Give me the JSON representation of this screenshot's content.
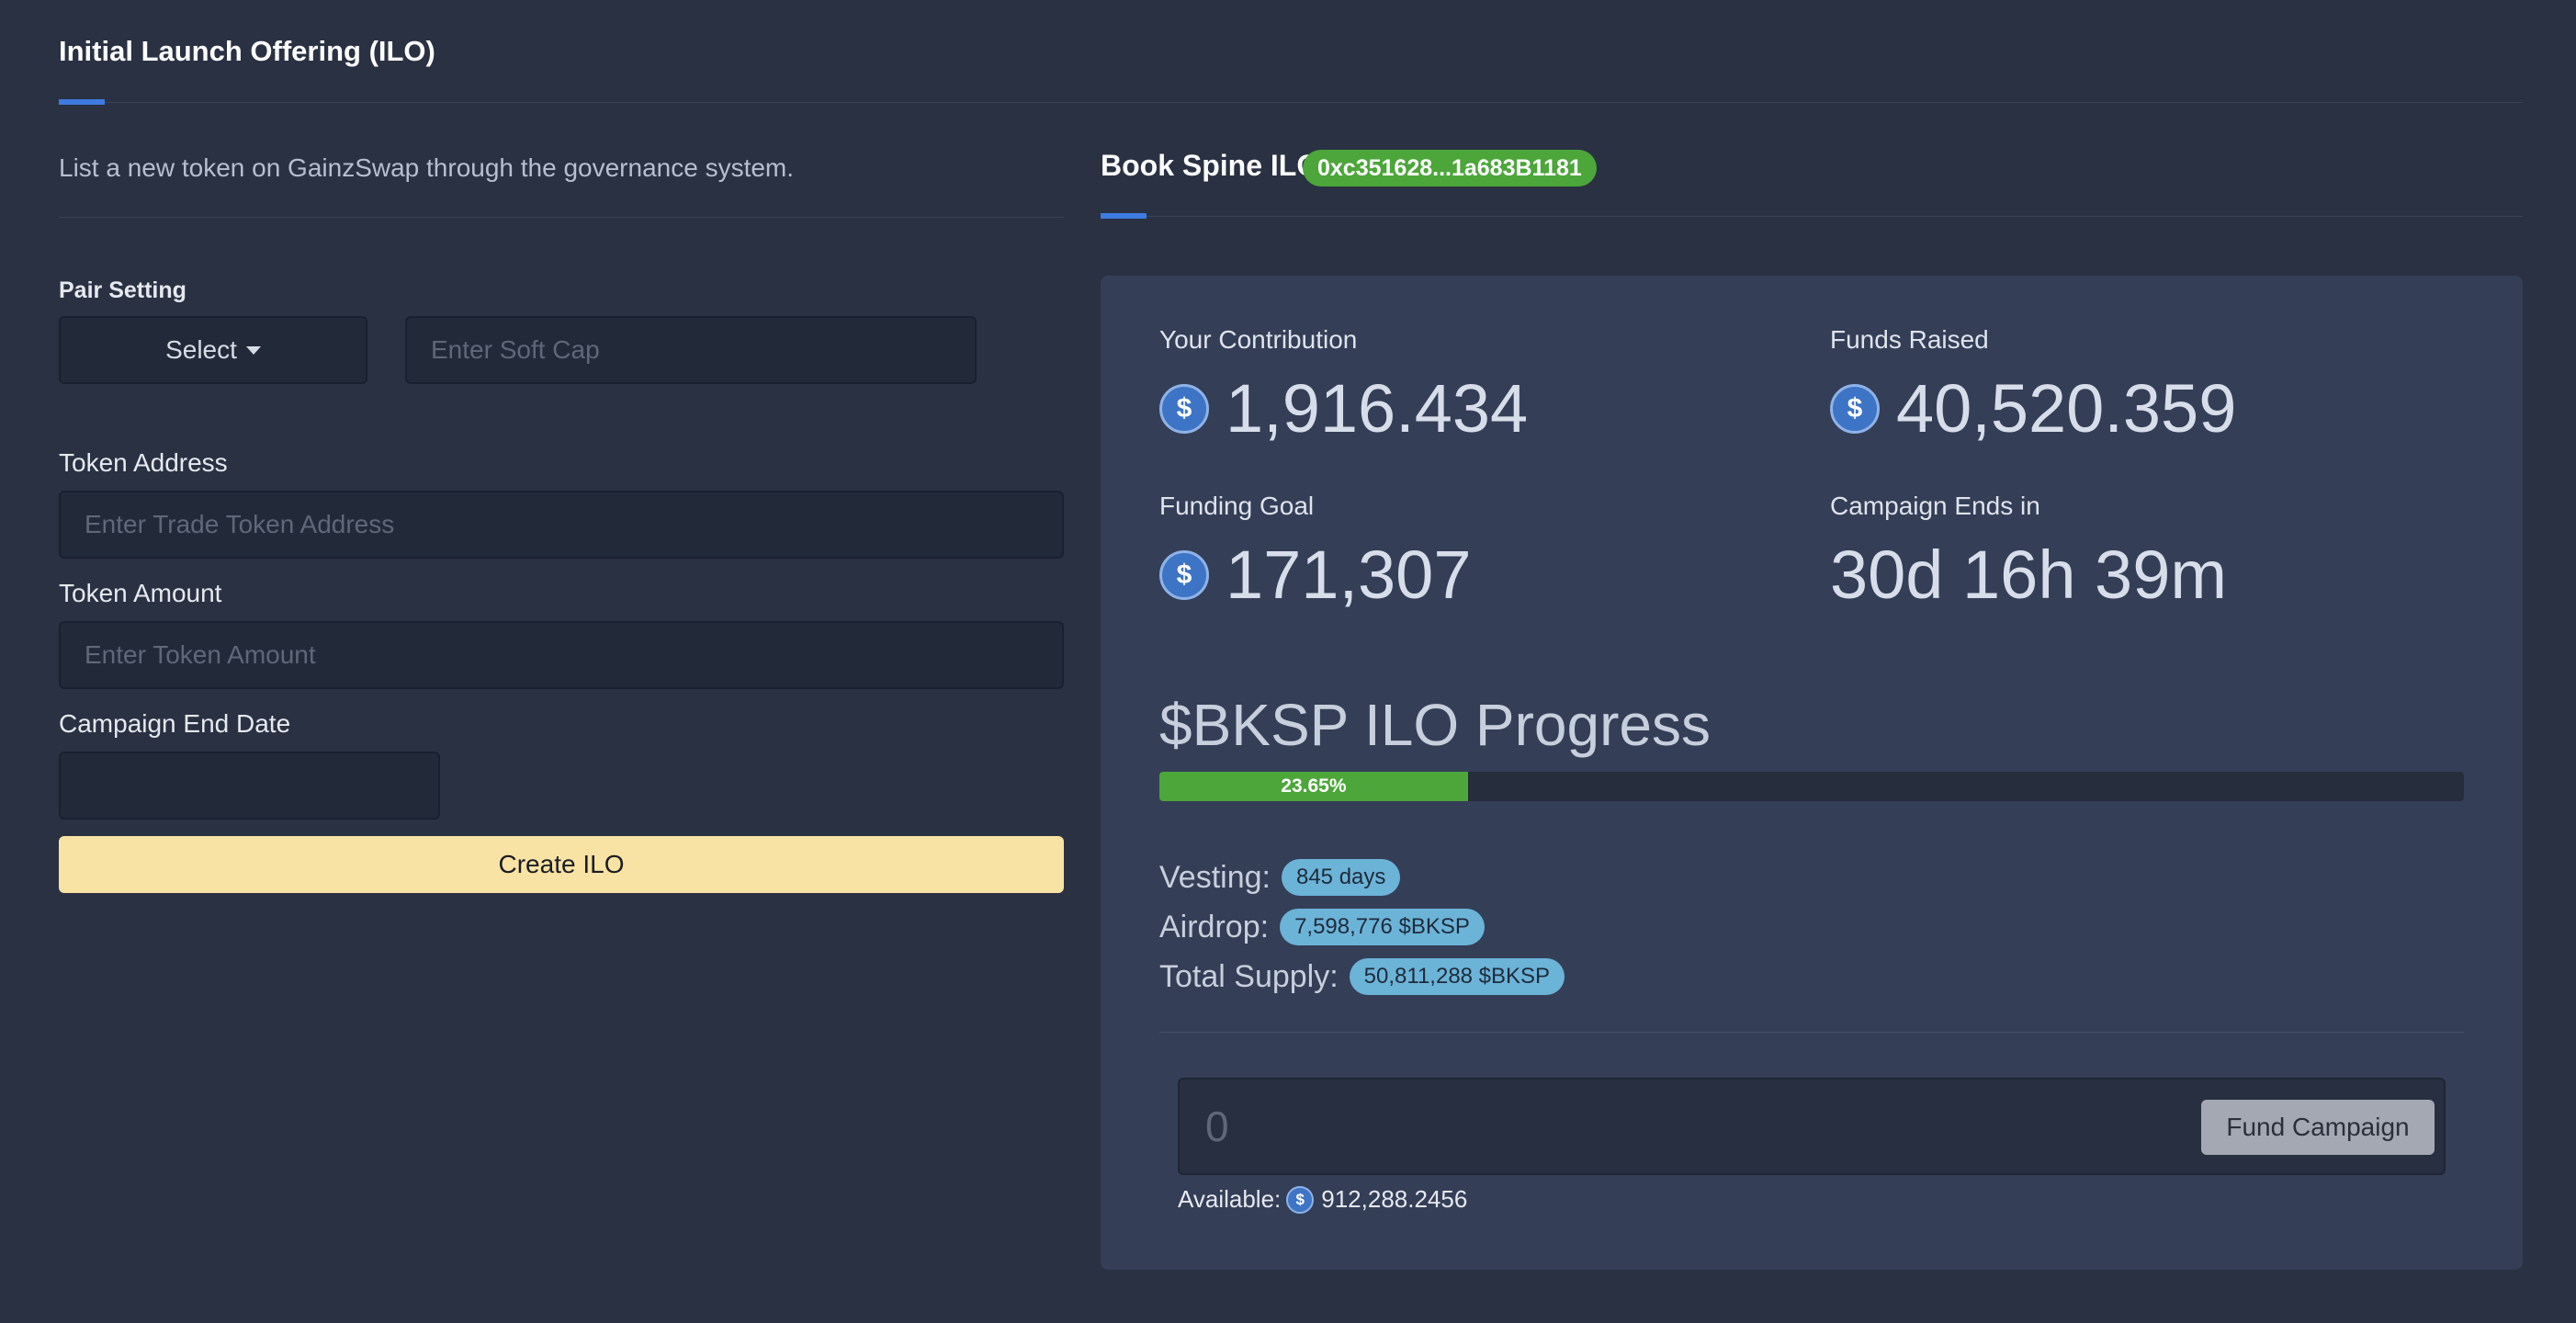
{
  "header": {
    "title": "Initial Launch Offering (ILO)"
  },
  "left": {
    "subtitle": "List a new token on GainzSwap through the governance system.",
    "pair_setting_label": "Pair Setting",
    "select_label": "Select",
    "soft_cap_placeholder": "Enter Soft Cap",
    "token_address_label": "Token Address",
    "token_address_placeholder": "Enter Trade Token Address",
    "token_amount_label": "Token Amount",
    "token_amount_placeholder": "Enter Token Amount",
    "end_date_label": "Campaign End Date",
    "create_button": "Create ILO"
  },
  "right": {
    "title": "Book Spine ILO",
    "address": "0xc351628...1a683B1181",
    "stats": {
      "contribution_label": "Your Contribution",
      "contribution_value": "1,916.434",
      "raised_label": "Funds Raised",
      "raised_value": "40,520.359",
      "goal_label": "Funding Goal",
      "goal_value": "171,307",
      "ends_label": "Campaign Ends in",
      "ends_value": "30d 16h 39m"
    },
    "progress_title": "$BKSP ILO Progress",
    "progress_text": "23.65%",
    "progress_percent": 23.65,
    "vesting_label": "Vesting:",
    "vesting_value": "845 days",
    "airdrop_label": "Airdrop:",
    "airdrop_value": "7,598,776 $BKSP",
    "supply_label": "Total Supply:",
    "supply_value": "50,811,288 $BKSP",
    "fund_placeholder": "0",
    "fund_button": "Fund Campaign",
    "available_label": "Available:",
    "available_value": "912,288.2456"
  },
  "icons": {
    "coin": "usdc-coin-icon",
    "caret": "caret-down-icon"
  },
  "colors": {
    "accent": "#3d7be0",
    "success": "#4ca63a",
    "cta": "#f9e3a4",
    "pill": "#6cb3d8"
  }
}
